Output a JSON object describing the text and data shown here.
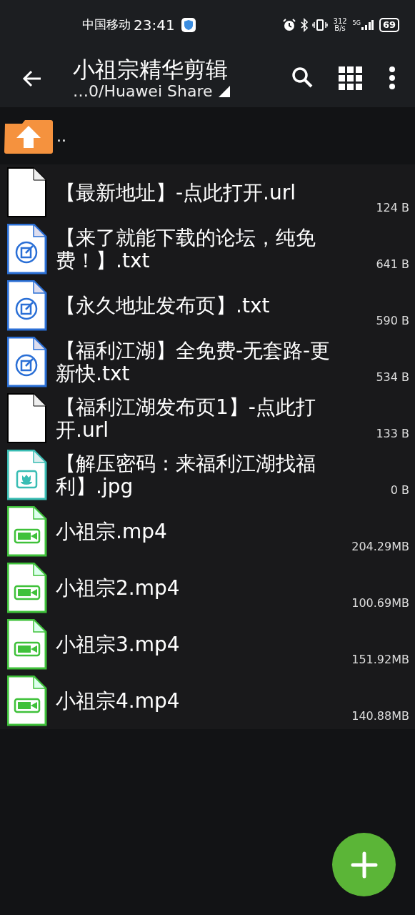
{
  "status_bar": {
    "carrier": "中国移动",
    "time": "23:41",
    "net_speed_value": "312",
    "net_speed_unit": "B/s",
    "network": "5G",
    "battery": "69"
  },
  "toolbar": {
    "title": "小祖宗精华剪辑",
    "path": "…0/Huawei Share"
  },
  "parent_entry": {
    "label": ".."
  },
  "files": [
    {
      "name": "【最新地址】-点此打开.url",
      "size": "124 B",
      "kind": "generic"
    },
    {
      "name": "【来了就能下载的论坛，纯免费！】.txt",
      "size": "641 B",
      "kind": "text"
    },
    {
      "name": "【永久地址发布页】.txt",
      "size": "590 B",
      "kind": "text"
    },
    {
      "name": "【福利江湖】全免费-无套路-更新快.txt",
      "size": "534 B",
      "kind": "text"
    },
    {
      "name": "【福利江湖发布页1】-点此打开.url",
      "size": "133 B",
      "kind": "generic"
    },
    {
      "name": "【解压密码：来福利江湖找福利】.jpg",
      "size": "0 B",
      "kind": "image"
    },
    {
      "name": "小祖宗.mp4",
      "size": "204.29MB",
      "kind": "video"
    },
    {
      "name": "小祖宗2.mp4",
      "size": "100.69MB",
      "kind": "video"
    },
    {
      "name": "小祖宗3.mp4",
      "size": "151.92MB",
      "kind": "video"
    },
    {
      "name": "小祖宗4.mp4",
      "size": "140.88MB",
      "kind": "video"
    }
  ]
}
